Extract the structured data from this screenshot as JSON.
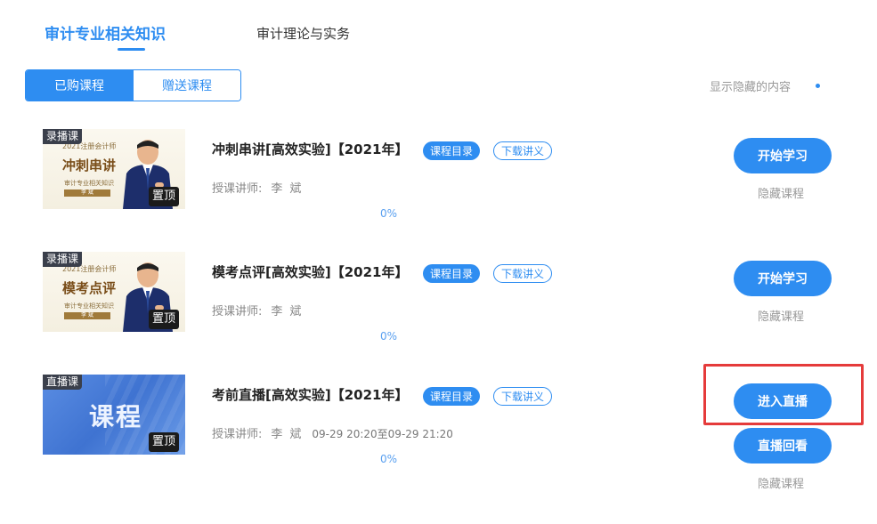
{
  "tabs": [
    {
      "label": "审计专业相关知识",
      "active": true
    },
    {
      "label": "审计理论与实务",
      "active": false
    }
  ],
  "segment": {
    "purchased": "已购课程",
    "gifted": "赠送课程"
  },
  "show_hidden": "显示隐藏的内容",
  "colors": {
    "accent": "#2e8df1",
    "highlight": "#e53b3b"
  },
  "courses": [
    {
      "badge": "录播课",
      "thumb_small": "2021注册会计师",
      "thumb_title": "冲刺串讲",
      "thumb_sub": "审计专业相关知识",
      "thumb_name": "李 斌",
      "pin": "置顶",
      "title": "冲刺串讲[高效实验]【2021年】",
      "catalog": "课程目录",
      "download": "下载讲义",
      "teacher_label": "授课讲师:",
      "teacher_name": "李斌",
      "time": "",
      "progress": "0%",
      "primary_btn": "开始学习",
      "hide": "隐藏课程"
    },
    {
      "badge": "录播课",
      "thumb_small": "2021注册会计师",
      "thumb_title": "模考点评",
      "thumb_sub": "审计专业相关知识",
      "thumb_name": "李 斌",
      "pin": "置顶",
      "title": "模考点评[高效实验]【2021年】",
      "catalog": "课程目录",
      "download": "下载讲义",
      "teacher_label": "授课讲师:",
      "teacher_name": "李斌",
      "time": "",
      "progress": "0%",
      "primary_btn": "开始学习",
      "hide": "隐藏课程"
    },
    {
      "badge": "直播课",
      "thumb_title": "课程",
      "pin": "置顶",
      "title": "考前直播[高效实验]【2021年】",
      "catalog": "课程目录",
      "download": "下载讲义",
      "teacher_label": "授课讲师:",
      "teacher_name": "李斌",
      "time": "09-29 20:20至09-29 21:20",
      "progress": "0%",
      "primary_btn": "进入直播",
      "secondary_btn": "直播回看",
      "hide": "隐藏课程"
    }
  ]
}
